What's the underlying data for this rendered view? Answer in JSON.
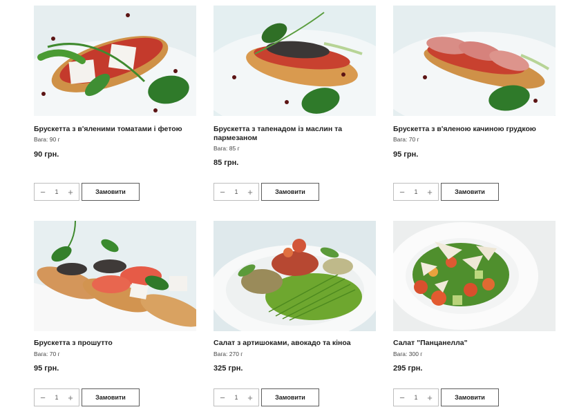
{
  "products": [
    {
      "title": "Брускетта з в'яленими томатами і фетою",
      "weight": "Вага: 90 г",
      "price": "90 грн.",
      "image_icon": "bruschetta-feta-photo",
      "qty": "1",
      "order_label": "Замовити"
    },
    {
      "title": "Брускетта з тапенадом із маслин та пармезаном",
      "weight": "Вага: 85 г",
      "price": "85 грн.",
      "image_icon": "bruschetta-tapenade-photo",
      "qty": "1",
      "order_label": "Замовити"
    },
    {
      "title": "Брускетта з в'яленою качиною грудкою",
      "weight": "Вага: 70 г",
      "price": "95 грн.",
      "image_icon": "bruschetta-duck-photo",
      "qty": "1",
      "order_label": "Замовити"
    },
    {
      "title": "Брускетта з прошутто",
      "weight": "Вага: 70 г",
      "price": "95 грн.",
      "image_icon": "bruschetta-prosciutto-photo",
      "qty": "1",
      "order_label": "Замовити"
    },
    {
      "title": "Салат з артишоками, авокадо та кіноа",
      "weight": "Вага: 270 г",
      "price": "325 грн.",
      "image_icon": "avocado-salad-photo",
      "qty": "1",
      "order_label": "Замовити"
    },
    {
      "title": "Салат \"Панцанелла\"",
      "weight": "Вага: 300 г",
      "price": "295 грн.",
      "image_icon": "panzanella-salad-photo",
      "qty": "1",
      "order_label": "Замовити"
    }
  ],
  "stepper": {
    "minus": "−",
    "plus": "+"
  },
  "colors": {
    "text": "#1e1e1e",
    "border": "#bdbdbd",
    "button_border": "#5a5a5a",
    "background": "#ffffff"
  }
}
